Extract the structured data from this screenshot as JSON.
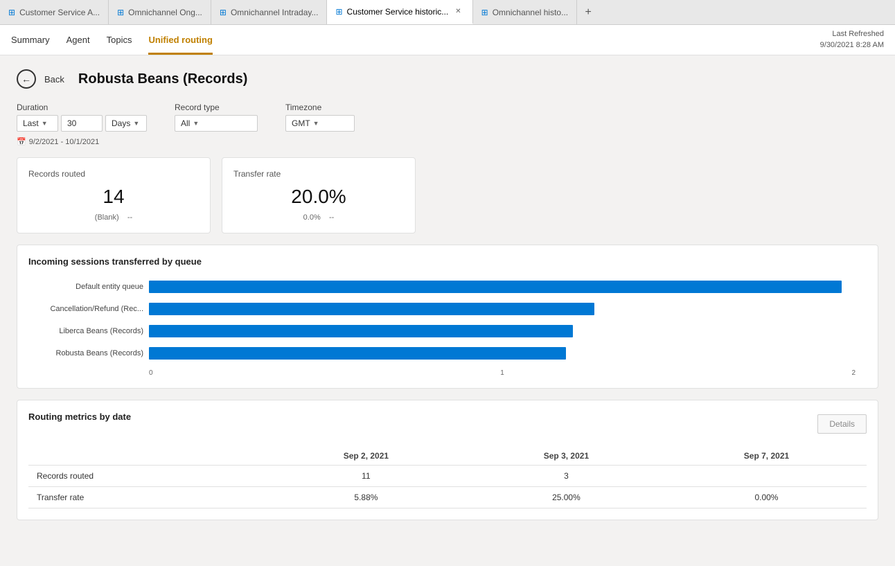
{
  "tabs": [
    {
      "id": "tab1",
      "label": "Customer Service A...",
      "icon": "⊞",
      "active": false,
      "closeable": false
    },
    {
      "id": "tab2",
      "label": "Omnichannel Ong...",
      "icon": "⊞",
      "active": false,
      "closeable": false
    },
    {
      "id": "tab3",
      "label": "Omnichannel Intraday...",
      "icon": "⊞",
      "active": false,
      "closeable": false
    },
    {
      "id": "tab4",
      "label": "Customer Service historic...",
      "icon": "⊞",
      "active": true,
      "closeable": true
    },
    {
      "id": "tab5",
      "label": "Omnichannel histo...",
      "icon": "⊞",
      "active": false,
      "closeable": false
    }
  ],
  "nav": {
    "tabs": [
      {
        "id": "summary",
        "label": "Summary",
        "active": false
      },
      {
        "id": "agent",
        "label": "Agent",
        "active": false
      },
      {
        "id": "topics",
        "label": "Topics",
        "active": false
      },
      {
        "id": "unified-routing",
        "label": "Unified routing",
        "active": true
      }
    ],
    "last_refreshed_label": "Last Refreshed",
    "last_refreshed_value": "9/30/2021 8:28 AM"
  },
  "back": {
    "label": "Back"
  },
  "page_title": "Robusta Beans (Records)",
  "filters": {
    "duration": {
      "label": "Duration",
      "prefix": "Last",
      "value": "30",
      "unit": "Days"
    },
    "record_type": {
      "label": "Record type",
      "value": "All"
    },
    "timezone": {
      "label": "Timezone",
      "value": "GMT"
    },
    "date_range": "9/2/2021 - 10/1/2021"
  },
  "cards": {
    "records_routed": {
      "title": "Records routed",
      "value": "14",
      "sub_label": "(Blank)",
      "sub_value": "--"
    },
    "transfer_rate": {
      "title": "Transfer rate",
      "value": "20.0%",
      "sub_label": "0.0%",
      "sub_value": "--"
    }
  },
  "chart": {
    "title": "Incoming sessions transferred by queue",
    "bars": [
      {
        "label": "Default entity queue",
        "pct": 98
      },
      {
        "label": "Cancellation/Refund (Rec...",
        "pct": 63
      },
      {
        "label": "Liberca Beans (Records)",
        "pct": 60
      },
      {
        "label": "Robusta Beans (Records)",
        "pct": 59
      }
    ],
    "axis_labels": [
      "0",
      "1",
      "2"
    ]
  },
  "routing_metrics": {
    "title": "Routing metrics by date",
    "details_button": "Details",
    "columns": [
      "",
      "Sep 2, 2021",
      "Sep 3, 2021",
      "Sep 7, 2021"
    ],
    "rows": [
      {
        "metric": "Records routed",
        "values": [
          "11",
          "3",
          ""
        ]
      },
      {
        "metric": "Transfer rate",
        "values": [
          "5.88%",
          "25.00%",
          "0.00%"
        ]
      }
    ]
  }
}
